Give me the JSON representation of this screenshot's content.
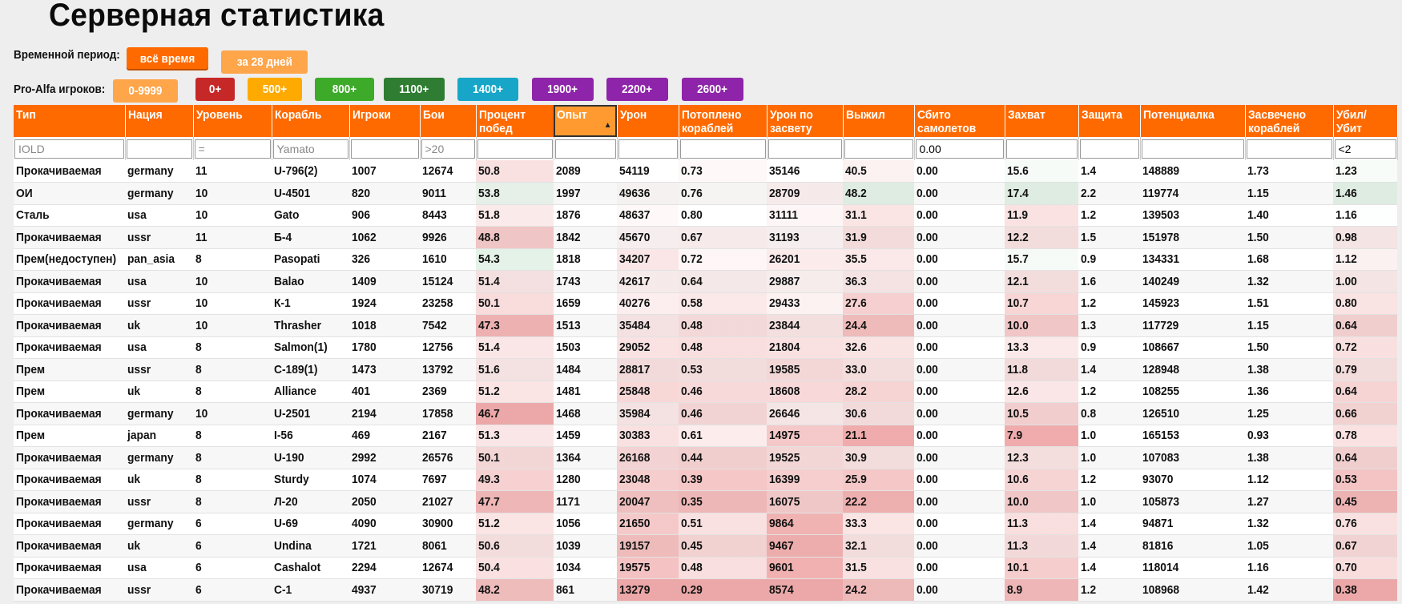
{
  "page": {
    "title": "Серверная статистика"
  },
  "filters": {
    "period_label": "Временной период:",
    "period_buttons": [
      {
        "label": "всё время",
        "color": "#ff6a00"
      },
      {
        "label": "за 28 дней",
        "color": "#ffa54a"
      }
    ],
    "players_label": "Pro-Alfa игроков:",
    "player_buttons": [
      {
        "label": "0-9999",
        "color": "#ffa54a"
      },
      {
        "label": "0+",
        "color": "#c62828"
      },
      {
        "label": "500+",
        "color": "#ffaa00"
      },
      {
        "label": "800+",
        "color": "#3daa2a"
      },
      {
        "label": "1100+",
        "color": "#2e7d32"
      },
      {
        "label": "1400+",
        "color": "#17a6c8"
      },
      {
        "label": "1900+",
        "color": "#8e24aa"
      },
      {
        "label": "2200+",
        "color": "#8e24aa"
      },
      {
        "label": "2600+",
        "color": "#8e24aa"
      }
    ]
  },
  "table": {
    "columns": [
      "Тип",
      "Нация",
      "Уровень",
      "Корабль",
      "Игроки",
      "Бои",
      "Процент побед",
      "Опыт",
      "Урон",
      "Потоплено кораблей",
      "Урон по засвету",
      "Выжил",
      "Сбито самолетов",
      "Захват",
      "Защита",
      "Потенциалка",
      "Засвечено кораблей",
      "Убил/ Убит"
    ],
    "sorted_column": "Опыт",
    "filter_values": [
      "",
      "",
      "",
      "",
      "",
      "",
      "",
      "",
      "",
      "",
      "",
      "",
      "0.00",
      "",
      "",
      "",
      "",
      "<2"
    ],
    "filter_placeholders": [
      "IOLD",
      "",
      "=",
      "Yamato",
      "",
      ">20",
      "",
      "",
      "",
      "",
      "",
      "",
      "",
      "",
      "",
      "",
      "",
      ""
    ],
    "rows": [
      [
        "Прокачиваемая",
        "germany",
        "11",
        "U-796(2)",
        "1007",
        "12674",
        "50.8",
        "2089",
        "54119",
        "0.73",
        "35146",
        "40.5",
        "0.00",
        "15.6",
        "1.4",
        "148889",
        "1.73",
        "1.23"
      ],
      [
        "ОИ",
        "germany",
        "10",
        "U-4501",
        "820",
        "9011",
        "53.8",
        "1997",
        "49636",
        "0.76",
        "28709",
        "48.2",
        "0.00",
        "17.4",
        "2.2",
        "119774",
        "1.15",
        "1.46"
      ],
      [
        "Сталь",
        "usa",
        "10",
        "Gato",
        "906",
        "8443",
        "51.8",
        "1876",
        "48637",
        "0.80",
        "31111",
        "31.1",
        "0.00",
        "11.9",
        "1.2",
        "139503",
        "1.40",
        "1.16"
      ],
      [
        "Прокачиваемая",
        "ussr",
        "11",
        "Б-4",
        "1062",
        "9926",
        "48.8",
        "1842",
        "45670",
        "0.67",
        "31193",
        "31.9",
        "0.00",
        "12.2",
        "1.5",
        "151978",
        "1.50",
        "0.98"
      ],
      [
        "Прем(недоступен)",
        "pan_asia",
        "8",
        "Pasopati",
        "326",
        "1610",
        "54.3",
        "1818",
        "34207",
        "0.72",
        "26201",
        "35.5",
        "0.00",
        "15.7",
        "0.9",
        "134331",
        "1.68",
        "1.12"
      ],
      [
        "Прокачиваемая",
        "usa",
        "10",
        "Balao",
        "1409",
        "15124",
        "51.4",
        "1743",
        "42617",
        "0.64",
        "29887",
        "36.3",
        "0.00",
        "12.1",
        "1.6",
        "140249",
        "1.32",
        "1.00"
      ],
      [
        "Прокачиваемая",
        "ussr",
        "10",
        "К-1",
        "1924",
        "23258",
        "50.1",
        "1659",
        "40276",
        "0.58",
        "29433",
        "27.6",
        "0.00",
        "10.7",
        "1.2",
        "145923",
        "1.51",
        "0.80"
      ],
      [
        "Прокачиваемая",
        "uk",
        "10",
        "Thrasher",
        "1018",
        "7542",
        "47.3",
        "1513",
        "35484",
        "0.48",
        "23844",
        "24.4",
        "0.00",
        "10.0",
        "1.3",
        "117729",
        "1.15",
        "0.64"
      ],
      [
        "Прокачиваемая",
        "usa",
        "8",
        "Salmon(1)",
        "1780",
        "12756",
        "51.4",
        "1503",
        "29052",
        "0.48",
        "21804",
        "32.6",
        "0.00",
        "13.3",
        "0.9",
        "108667",
        "1.50",
        "0.72"
      ],
      [
        "Прем",
        "ussr",
        "8",
        "С-189(1)",
        "1473",
        "13792",
        "51.6",
        "1484",
        "28817",
        "0.53",
        "19585",
        "33.0",
        "0.00",
        "11.8",
        "1.4",
        "128948",
        "1.38",
        "0.79"
      ],
      [
        "Прем",
        "uk",
        "8",
        "Alliance",
        "401",
        "2369",
        "51.2",
        "1481",
        "25848",
        "0.46",
        "18608",
        "28.2",
        "0.00",
        "12.6",
        "1.2",
        "108255",
        "1.36",
        "0.64"
      ],
      [
        "Прокачиваемая",
        "germany",
        "10",
        "U-2501",
        "2194",
        "17858",
        "46.7",
        "1468",
        "35984",
        "0.46",
        "26646",
        "30.6",
        "0.00",
        "10.5",
        "0.8",
        "126510",
        "1.25",
        "0.66"
      ],
      [
        "Прем",
        "japan",
        "8",
        "I-56",
        "469",
        "2167",
        "51.3",
        "1459",
        "30383",
        "0.61",
        "14975",
        "21.1",
        "0.00",
        "7.9",
        "1.0",
        "165153",
        "0.93",
        "0.78"
      ],
      [
        "Прокачиваемая",
        "germany",
        "8",
        "U-190",
        "2992",
        "26576",
        "50.1",
        "1364",
        "26168",
        "0.44",
        "19525",
        "30.9",
        "0.00",
        "12.3",
        "1.0",
        "107083",
        "1.38",
        "0.64"
      ],
      [
        "Прокачиваемая",
        "uk",
        "8",
        "Sturdy",
        "1074",
        "7697",
        "49.3",
        "1280",
        "23048",
        "0.39",
        "16399",
        "25.9",
        "0.00",
        "10.6",
        "1.2",
        "93070",
        "1.12",
        "0.53"
      ],
      [
        "Прокачиваемая",
        "ussr",
        "8",
        "Л-20",
        "2050",
        "21027",
        "47.7",
        "1171",
        "20047",
        "0.35",
        "16075",
        "22.2",
        "0.00",
        "10.0",
        "1.0",
        "105873",
        "1.27",
        "0.45"
      ],
      [
        "Прокачиваемая",
        "germany",
        "6",
        "U-69",
        "4090",
        "30900",
        "51.2",
        "1056",
        "21650",
        "0.51",
        "9864",
        "33.3",
        "0.00",
        "11.3",
        "1.4",
        "94871",
        "1.32",
        "0.76"
      ],
      [
        "Прокачиваемая",
        "uk",
        "6",
        "Undina",
        "1721",
        "8061",
        "50.6",
        "1039",
        "19157",
        "0.45",
        "9467",
        "32.1",
        "0.00",
        "11.3",
        "1.4",
        "81816",
        "1.05",
        "0.67"
      ],
      [
        "Прокачиваемая",
        "usa",
        "6",
        "Cashalot",
        "2294",
        "12674",
        "50.4",
        "1034",
        "19575",
        "0.48",
        "9601",
        "31.5",
        "0.00",
        "10.1",
        "1.4",
        "118014",
        "1.16",
        "0.70"
      ],
      [
        "Прокачиваемая",
        "ussr",
        "6",
        "С-1",
        "4937",
        "30719",
        "48.2",
        "861",
        "13279",
        "0.29",
        "8574",
        "24.2",
        "0.00",
        "8.9",
        "1.2",
        "108968",
        "1.42",
        "0.38"
      ]
    ]
  }
}
